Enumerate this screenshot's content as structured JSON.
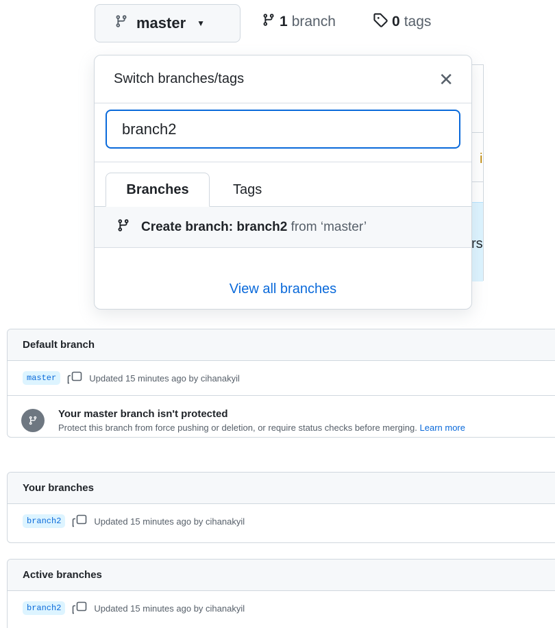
{
  "top_bar": {
    "branch_button_label": "master",
    "branch_count": "1",
    "branch_word": "branch",
    "tag_count": "0",
    "tag_word": "tags"
  },
  "popup": {
    "title": "Switch branches/tags",
    "close_glyph": "✕",
    "filter_value": "branch2",
    "tabs": [
      {
        "label": "Branches",
        "active": true
      },
      {
        "label": "Tags",
        "active": false
      }
    ],
    "create_prefix": "Create branch: branch2",
    "create_suffix": "from ‘master’",
    "view_all_label": "View all branches"
  },
  "backdrop_fragments": {
    "frag_i": "i",
    "frag_r": "rs"
  },
  "default_section": {
    "header": "Default branch",
    "branch_name": "master",
    "updated_text": "Updated 15 minutes ago by cihanakyil",
    "notice_title": "Your master branch isn't protected",
    "notice_desc": "Protect this branch from force pushing or deletion, or require status checks before merging.",
    "notice_link": "Learn more"
  },
  "your_section": {
    "header": "Your branches",
    "branch_name": "branch2",
    "updated_text": "Updated 15 minutes ago by cihanakyil"
  },
  "active_section": {
    "header": "Active branches",
    "branch_name": "branch2",
    "updated_text": "Updated 15 minutes ago by cihanakyil"
  },
  "colors": {
    "accent": "#0969da",
    "pill_bg": "#ddf4ff",
    "border": "#d0d7de",
    "header_bg": "#f6f8fa",
    "muted_text": "#57606a"
  },
  "icons": [
    "git-branch-icon",
    "caret-down-icon",
    "tag-icon",
    "close-icon",
    "copy-icon"
  ]
}
